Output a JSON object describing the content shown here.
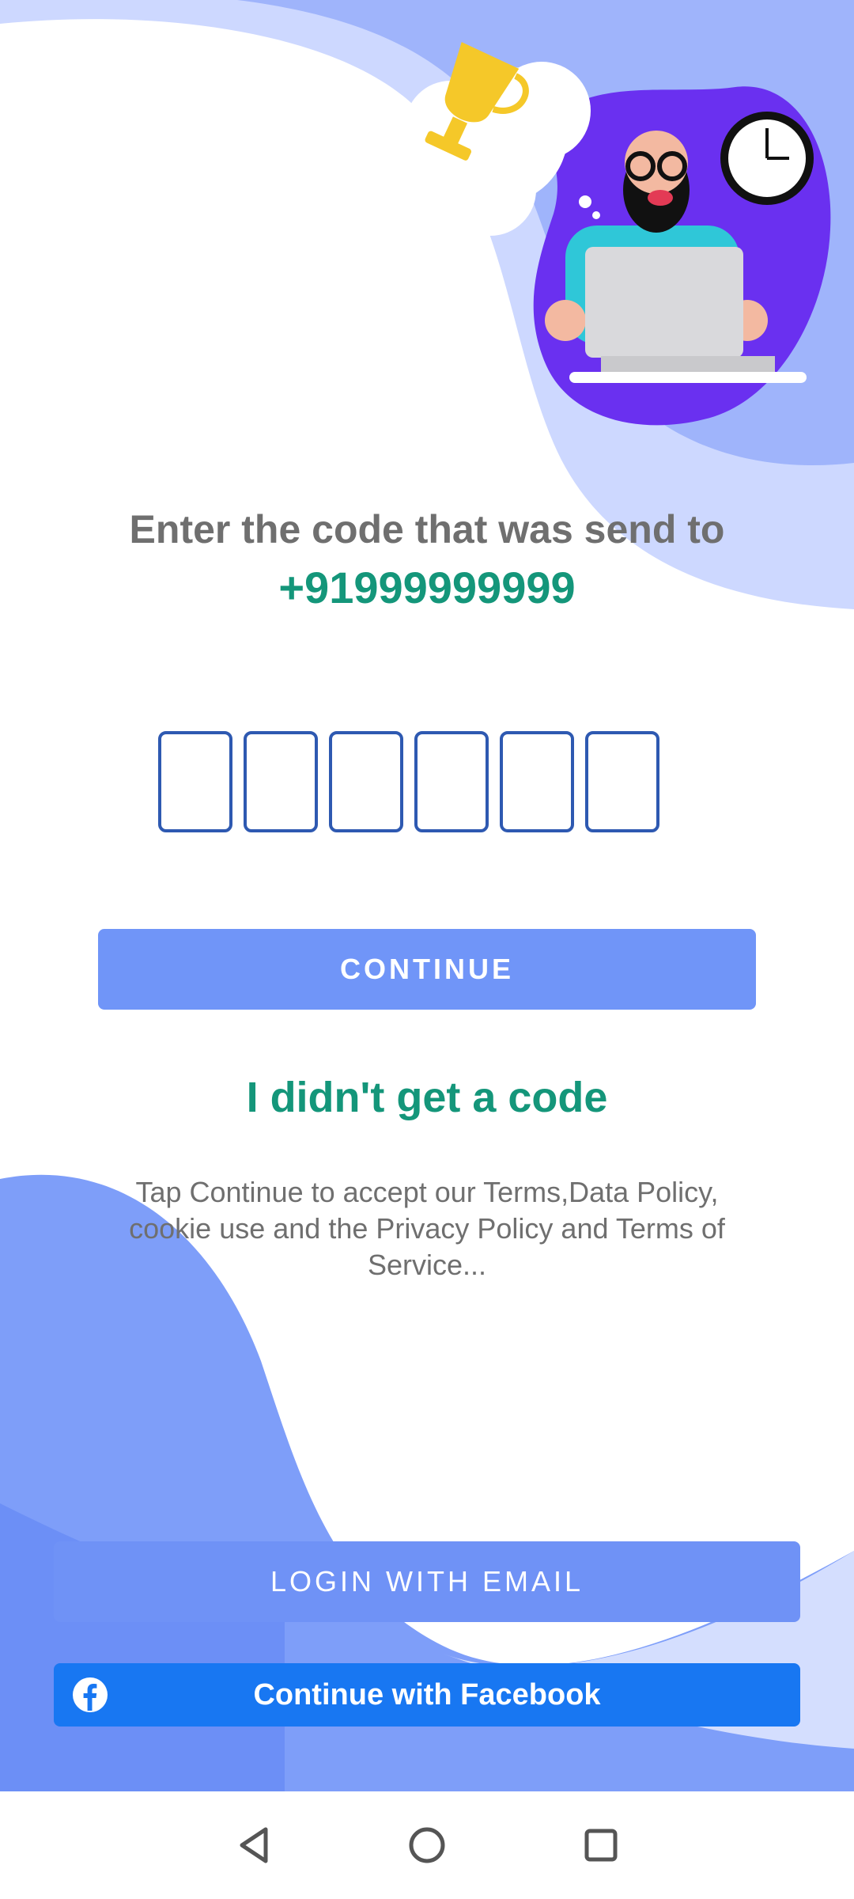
{
  "header": {
    "title": "Enter the code that was send to",
    "phone": "+91999999999"
  },
  "code_inputs": [
    "",
    "",
    "",
    "",
    "",
    ""
  ],
  "buttons": {
    "continue": "CONTINUE",
    "resend": "I didn't get a code",
    "login_email": "LOGIN WITH EMAIL",
    "facebook": "Continue with Facebook"
  },
  "terms_text": "Tap Continue to accept our Terms,Data Policy, cookie use and the Privacy Policy and Terms of Service...",
  "icons": {
    "facebook": "facebook-icon",
    "nav_back": "back-triangle-icon",
    "nav_home": "home-circle-icon",
    "nav_recents": "recents-square-icon"
  },
  "colors": {
    "accent_green": "#14967a",
    "button_blue": "#7095f8",
    "facebook_blue": "#1877f2",
    "code_border": "#2e59b1",
    "wave_purple": "#6a30f0"
  }
}
